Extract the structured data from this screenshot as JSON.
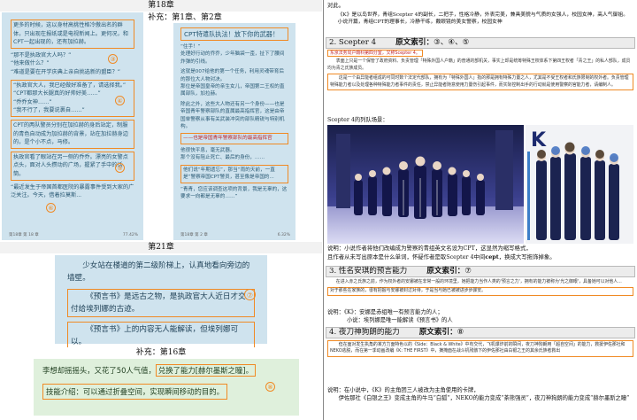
{
  "left": {
    "chapter18": "第18章",
    "supplement12": "补充：第1章、第2章",
    "chapter21": "第21章",
    "supplement16": "补充：第16章",
    "page_a": {
      "paras": [
        "更多的时候，这以身材高挑性格冷傲出名的群体，只出现在报纸或是电视新闻上。更何况，和CPT一起出现的，还有加拉赫。",
        "“那不是执政官大人吗？”\n“他来做什么？”\n“难道是要在开学庆典上亲自挑选新的盟臣？”",
        "“执政官大人，我已经做好准备了，请选择我。”\n“CPT都那大长腿真的好帅好美……”\n“乔乔女神……”\n“我不行了，我要说裹自……”",
        "CPT的两队警员分别在加拉赫的身后站定，制服的青色自动成为加拉赫的背景，站在加拉赫身边的，是个小不点，马修。",
        "执政官看了眼站在另一侧的乔乔。漂亮的女警点点头，面对人头攒动的广场，握紧了手中的话筒。",
        "“最近发生于帝国首都医院的暴露事件受到大家的广泛关注。今天，借着拉莫斯..."
      ],
      "footer_l": "第18章  第 18 章",
      "footer_r": "77.42%"
    },
    "page_b": {
      "paras": [
        "CPT特遣队执法！放下你的武器！",
        "“住手！”\n处理好行动的乔乔，少年脑袋一歪，扯下了腰间炸弹的引线。",
        "这就是007给他的第一个任务，利用灵魂带育后的那位大人物对决。\n那位是帝国皇帝的亲生女儿，帝国第二王权的直属部队，加拉赫。",
        "除此之外，这些大人物还有另一个身份——也是帝国青年警察部队的直属最高指挥官，这是由帝国单警察从事有关武装冲突的部队精锐与特别机构。",
        "他很快平息，毫无武器。\n那个没有阻止死亡、最后的身份，……",
        "他们说“年期遗忘”，那当“雨的天前，一直是”警察帝国CPT警员，甚至像是帝国的...",
        "“青青，您应该调查这项的背景，我是无辜的，这要求一向都是无辜的……”"
      ],
      "highlight": "——也是帝国青年警察部队的最高指挥官",
      "footer_l": "第18章  第 2 章",
      "footer_r": "6.32%"
    },
    "page_c": {
      "paras": [
        "少女站在楼道的第二级阶梯上，认真地看向旁边的墙壁。",
        "《预言书》是远古之物，是执政官大人近日才交付给埃列娜的古迹。",
        "《预言书》上的内容无人能解读，但埃列娜可以。"
      ]
    },
    "page_d": {
      "line1_pre": "李想却摇摇头，又花了50人气值，",
      "line1_box": "兑换了能力[赫尔墨斯之瞳]。",
      "line2": "技能介绍：可以通过折叠空间，实现瞬间移动的目的。"
    },
    "circles": [
      "③",
      "④",
      "⑤",
      "⑥",
      "⑦",
      "⑧"
    ]
  },
  "right": {
    "top_line": "对此。",
    "intro": "《K》是以岛世界，青组Scepter 4的副长，二把手，性格冷静，外表完美，兼具美貌与气质的女强人，校园女神，高人气御姐。",
    "intro2": "小说开篇，青组CPT的理事长，冷静干练，戴眼镜的美女警察，校园女神",
    "sec2_title": "2. Scepter 4",
    "sec2_label": "原文索引：",
    "sec2_refs": "③、④、⑤",
    "sec2_p1": "东京法务局户籍科第四分室，又称Scepter 4。",
    "sec2_p2": "表面上只是一个保管了政府资料、负责管理「特殊外国人户籍」的普通的部机关，事实上却是统筹特殊王权体系下第四王权者「青之王」的私人部队，成员均为青之氏族成员。",
    "sec2_p3": "这是一个由异能者组成的可同时数个法定代部队，拥有为「特殊外国人」指的那是拥有特殊力量之人，尤其是不受王权者和氏族限制的权外者。负责管理特殊能力者以及处理各种特殊能力者事件的责任，禁止异能者随意使用力量伤引起事件，而实际控制出手的行动就是使用警察的官能力者，请编制人。",
    "sec2_caption": "Scepter 4的列队场景：",
    "sec3_title": "3. 性名安琪的预言能力",
    "sec3_label": "原文索引：",
    "sec3_refs": "⑦",
    "sec3_p1": "在进入赤之氏族之前，作为权外者的安娜被在非常一般的环境里，她把能力当作人类的'预言之力'，拥有的能力被称为'光之御眼'，具备她可以对他人...",
    "sec3_p2": "对于那些在家族的，很有把握与安娜被封过对待，于是当与她已被被进步步骤安。",
    "sec3_note1": "说明：《K》：安娜是赤组唯一有预言能力的人；",
    "sec3_note2": "小说：埃列娜是唯一能解读《预言书》的人",
    "sec4_title": "4. 夜刀神狗朗的能力",
    "sec4_label": "原文索引：",
    "sec4_refs": "⑧",
    "sec4_p1": "但在面对发生执角的某方力面特色以的《Side：Black & White》中有交代，飞机爆炸前的瞬间，夜刀神狗朗用「超自空间」的能力，救援伊佐那社和NEKO逃脱，而在第一季动画改编《K: THE FIRST》中，摘掩面在战斗机残骸下的伊佐那社由白银之王的其余氏族者救出",
    "sec4_note1": "说明：在小说中，《K》的主角团三人被改为主角使用的卡牌，",
    "sec4_note2": "伊佐那社《白银之王》变成主角的牛马“白狐”，NEKO的能力变成“茶熊强灵”，夜刀神狗朗的能力变成“赫尔墨斯之瞳”",
    "colors": {
      "orange": "#f08a24",
      "red": "#c0272d",
      "blue_panel": "#cfe3ee",
      "green_panel": "#dff0dc"
    }
  }
}
